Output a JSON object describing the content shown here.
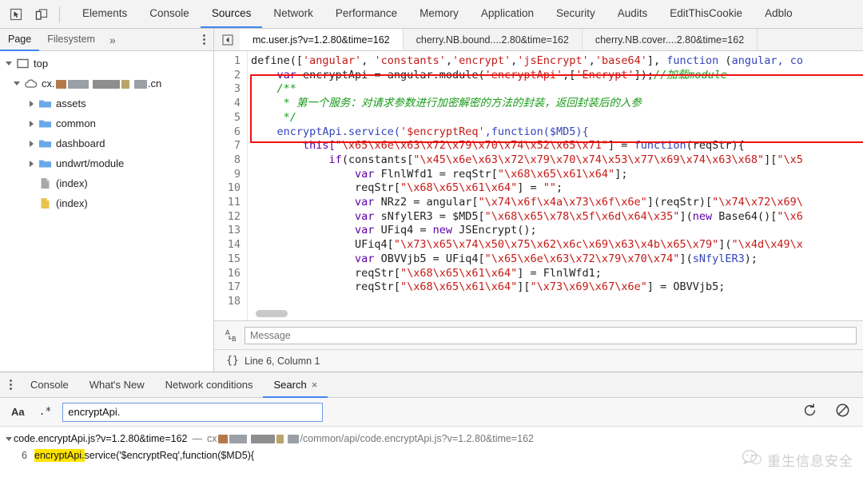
{
  "toolbar": {
    "inspect_icon": "inspect-element-icon",
    "device_icon": "device-toolbar-icon",
    "tabs": [
      {
        "label": "Elements",
        "active": false
      },
      {
        "label": "Console",
        "active": false
      },
      {
        "label": "Sources",
        "active": true
      },
      {
        "label": "Network",
        "active": false
      },
      {
        "label": "Performance",
        "active": false
      },
      {
        "label": "Memory",
        "active": false
      },
      {
        "label": "Application",
        "active": false
      },
      {
        "label": "Security",
        "active": false
      },
      {
        "label": "Audits",
        "active": false
      },
      {
        "label": "EditThisCookie",
        "active": false
      },
      {
        "label": "Adblo",
        "active": false
      }
    ]
  },
  "navigator": {
    "tabs": [
      {
        "label": "Page",
        "active": true
      },
      {
        "label": "Filesystem",
        "active": false
      }
    ],
    "more_label": "»",
    "menu_icon": "kebab-menu-icon",
    "tree": [
      {
        "label": "top",
        "icon": "frame-icon",
        "depth": 0,
        "expanded": true
      },
      {
        "label": "cx.███ ████ ██.cn",
        "icon": "cloud-icon",
        "depth": 1,
        "expanded": true,
        "redacted": true
      },
      {
        "label": "assets",
        "icon": "folder-icon",
        "depth": 2,
        "expanded": false
      },
      {
        "label": "common",
        "icon": "folder-icon",
        "depth": 2,
        "expanded": false
      },
      {
        "label": "dashboard",
        "icon": "folder-icon",
        "depth": 2,
        "expanded": false
      },
      {
        "label": "undwrt/module",
        "icon": "folder-icon",
        "depth": 2,
        "expanded": false
      },
      {
        "label": "(index)",
        "icon": "file-gray-icon",
        "depth": 2,
        "leaf": true
      },
      {
        "label": "(index)",
        "icon": "file-yellow-icon",
        "depth": 2,
        "leaf": true
      }
    ]
  },
  "editor": {
    "more_tabs_icon": "show-more-tabs-icon",
    "tabs": [
      {
        "label": "mc.user.js?v=1.2.80&time=162",
        "active": true
      },
      {
        "label": "cherry.NB.bound....2.80&time=162",
        "active": false
      },
      {
        "label": "cherry.NB.cover....2.80&time=162",
        "active": false
      }
    ],
    "line_numbers": [
      1,
      2,
      3,
      4,
      5,
      6,
      7,
      8,
      9,
      10,
      11,
      12,
      13,
      14,
      15,
      16,
      17,
      18
    ],
    "lines": [
      [
        {
          "t": "define([",
          "c": "plain"
        },
        {
          "t": "'angular'",
          "c": "str"
        },
        {
          "t": ", ",
          "c": "plain"
        },
        {
          "t": "'constants'",
          "c": "str"
        },
        {
          "t": ",",
          "c": "plain"
        },
        {
          "t": "'encrypt'",
          "c": "str"
        },
        {
          "t": ",",
          "c": "plain"
        },
        {
          "t": "'jsEncrypt'",
          "c": "str"
        },
        {
          "t": ",",
          "c": "plain"
        },
        {
          "t": "'base64'",
          "c": "str"
        },
        {
          "t": "], ",
          "c": "plain"
        },
        {
          "t": "function",
          "c": "fn"
        },
        {
          "t": " (",
          "c": "plain"
        },
        {
          "t": "angular, co",
          "c": "fn"
        }
      ],
      [
        {
          "t": "    ",
          "c": "plain"
        },
        {
          "t": "var",
          "c": "var"
        },
        {
          "t": " encryptApi = angular.module(",
          "c": "plain"
        },
        {
          "t": "'encryptApi'",
          "c": "str"
        },
        {
          "t": ",[",
          "c": "plain"
        },
        {
          "t": "'Encrypt'",
          "c": "str"
        },
        {
          "t": "]);",
          "c": "plain"
        },
        {
          "t": "//加载module",
          "c": "com"
        }
      ],
      [
        {
          "t": "    ",
          "c": "plain"
        },
        {
          "t": "/**",
          "c": "com"
        }
      ],
      [
        {
          "t": "     ",
          "c": "plain"
        },
        {
          "t": "* 第一个服务：对请求参数进行加密解密的方法的封装，返回封装后的入参",
          "c": "com"
        }
      ],
      [
        {
          "t": "     ",
          "c": "plain"
        },
        {
          "t": "*/",
          "c": "com"
        }
      ],
      [
        {
          "t": "    ",
          "c": "plain"
        },
        {
          "t": "encryptApi.service(",
          "c": "fn"
        },
        {
          "t": "'$encryptReq'",
          "c": "str"
        },
        {
          "t": ",",
          "c": "fn"
        },
        {
          "t": "function",
          "c": "fn"
        },
        {
          "t": "($MD5){",
          "c": "fn"
        }
      ],
      [
        {
          "t": "        ",
          "c": "plain"
        },
        {
          "t": "this[",
          "c": "var"
        },
        {
          "t": "\"\\x65\\x6e\\x63\\x72\\x79\\x70\\x74\\x52\\x65\\x71\"",
          "c": "str"
        },
        {
          "t": "] = ",
          "c": "plain"
        },
        {
          "t": "function",
          "c": "fn"
        },
        {
          "t": "(reqStr){",
          "c": "plain"
        }
      ],
      [
        {
          "t": "            ",
          "c": "plain"
        },
        {
          "t": "if",
          "c": "var"
        },
        {
          "t": "(constants[",
          "c": "plain"
        },
        {
          "t": "\"\\x45\\x6e\\x63\\x72\\x79\\x70\\x74\\x53\\x77\\x69\\x74\\x63\\x68\"",
          "c": "str"
        },
        {
          "t": "][",
          "c": "plain"
        },
        {
          "t": "\"\\x5",
          "c": "str"
        }
      ],
      [
        {
          "t": "                ",
          "c": "plain"
        },
        {
          "t": "var",
          "c": "var"
        },
        {
          "t": " FlnlWfd1 = reqStr[",
          "c": "plain"
        },
        {
          "t": "\"\\x68\\x65\\x61\\x64\"",
          "c": "str"
        },
        {
          "t": "];",
          "c": "plain"
        }
      ],
      [
        {
          "t": "                ",
          "c": "plain"
        },
        {
          "t": "reqStr[",
          "c": "plain"
        },
        {
          "t": "\"\\x68\\x65\\x61\\x64\"",
          "c": "str"
        },
        {
          "t": "] = ",
          "c": "plain"
        },
        {
          "t": "\"\"",
          "c": "str"
        },
        {
          "t": ";",
          "c": "plain"
        }
      ],
      [
        {
          "t": "                ",
          "c": "plain"
        },
        {
          "t": "var",
          "c": "var"
        },
        {
          "t": " NRz2 = angular[",
          "c": "plain"
        },
        {
          "t": "\"\\x74\\x6f\\x4a\\x73\\x6f\\x6e\"",
          "c": "str"
        },
        {
          "t": "](reqStr)[",
          "c": "plain"
        },
        {
          "t": "\"\\x74\\x72\\x69\\",
          "c": "str"
        }
      ],
      [
        {
          "t": "                ",
          "c": "plain"
        },
        {
          "t": "var",
          "c": "var"
        },
        {
          "t": " sNfylER3 = $MD5[",
          "c": "plain"
        },
        {
          "t": "\"\\x68\\x65\\x78\\x5f\\x6d\\x64\\x35\"",
          "c": "str"
        },
        {
          "t": "](",
          "c": "plain"
        },
        {
          "t": "new",
          "c": "var"
        },
        {
          "t": " Base64()[",
          "c": "plain"
        },
        {
          "t": "\"\\x6",
          "c": "str"
        }
      ],
      [
        {
          "t": "                ",
          "c": "plain"
        },
        {
          "t": "var",
          "c": "var"
        },
        {
          "t": " UFiq4 = ",
          "c": "plain"
        },
        {
          "t": "new",
          "c": "var"
        },
        {
          "t": " JSEncrypt();",
          "c": "plain"
        }
      ],
      [
        {
          "t": "                ",
          "c": "plain"
        },
        {
          "t": "UFiq4[",
          "c": "plain"
        },
        {
          "t": "\"\\x73\\x65\\x74\\x50\\x75\\x62\\x6c\\x69\\x63\\x4b\\x65\\x79\"",
          "c": "str"
        },
        {
          "t": "](",
          "c": "plain"
        },
        {
          "t": "\"\\x4d\\x49\\x",
          "c": "str"
        }
      ],
      [
        {
          "t": "                ",
          "c": "plain"
        },
        {
          "t": "var",
          "c": "var"
        },
        {
          "t": " OBVVjb5 = UFiq4[",
          "c": "plain"
        },
        {
          "t": "\"\\x65\\x6e\\x63\\x72\\x79\\x70\\x74\"",
          "c": "str"
        },
        {
          "t": "](",
          "c": "plain"
        },
        {
          "t": "sNfylER3",
          "c": "fn"
        },
        {
          "t": ");",
          "c": "plain"
        }
      ],
      [
        {
          "t": "                ",
          "c": "plain"
        },
        {
          "t": "reqStr[",
          "c": "plain"
        },
        {
          "t": "\"\\x68\\x65\\x61\\x64\"",
          "c": "str"
        },
        {
          "t": "] = FlnlWfd1;",
          "c": "plain"
        }
      ],
      [
        {
          "t": "                ",
          "c": "plain"
        },
        {
          "t": "reqStr[",
          "c": "plain"
        },
        {
          "t": "\"\\x68\\x65\\x61\\x64\"",
          "c": "str"
        },
        {
          "t": "][",
          "c": "plain"
        },
        {
          "t": "\"\\x73\\x69\\x67\\x6e\"",
          "c": "str"
        },
        {
          "t": "] = OBVVjb5;",
          "c": "plain"
        }
      ],
      []
    ],
    "highlight_color": "#ee1111",
    "message_icon": "pretty-print-icon",
    "message_placeholder": "Message",
    "status_icon": "format-braces-icon",
    "status_text": "Line 6, Column 1"
  },
  "drawer": {
    "menu_icon": "kebab-menu-icon",
    "tabs": [
      {
        "label": "Console",
        "active": false,
        "closable": false
      },
      {
        "label": "What's New",
        "active": false,
        "closable": false
      },
      {
        "label": "Network conditions",
        "active": false,
        "closable": false
      },
      {
        "label": "Search",
        "active": true,
        "closable": true,
        "close_label": "×"
      }
    ],
    "search": {
      "match_case_label": "Aa",
      "match_case_icon": "match-case-icon",
      "regex_label": ".*",
      "regex_icon": "regex-icon",
      "value": "encryptApi.",
      "placeholder": "",
      "refresh_icon": "refresh-icon",
      "clear_icon": "clear-icon"
    },
    "results": [
      {
        "expanded": true,
        "file": "code.encryptApi.js?v=1.2.80&time=162",
        "dash": "—",
        "url_prefix": "cx",
        "url_redacted": true,
        "url_suffix": "/common/api/code.encryptApi.js?v=1.2.80&time=162",
        "matches": [
          {
            "line": "6",
            "before": "",
            "hit": "encryptApi.",
            "after": "service('$encryptReq',function($MD5){"
          }
        ]
      }
    ]
  },
  "watermark": {
    "icon": "wechat-logo-icon",
    "text": "重生信息安全"
  }
}
